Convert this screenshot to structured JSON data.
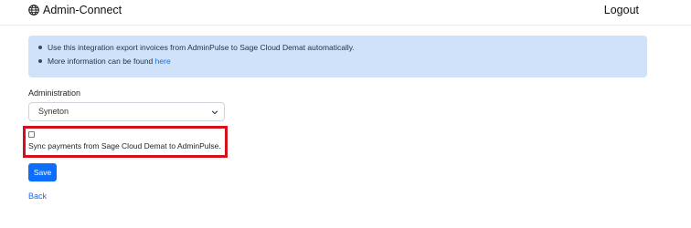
{
  "header": {
    "brand_icon": "globe-icon",
    "brand": "Admin-Connect",
    "logout": "Logout"
  },
  "info": {
    "line1": "Use this integration export invoices from AdminPulse to Sage Cloud Demat automatically.",
    "line2_text": "More information can be found ",
    "line2_link": "here"
  },
  "form": {
    "administration_label": "Administration",
    "administration_value": "Syneton",
    "sync_checked": false,
    "sync_label": "Sync payments from Sage Cloud Demat to AdminPulse.",
    "highlight_color": "#d6101b",
    "save": "Save",
    "back": "Back"
  },
  "colors": {
    "accent": "#0d6efd",
    "info_bg": "#cfe2f9"
  }
}
